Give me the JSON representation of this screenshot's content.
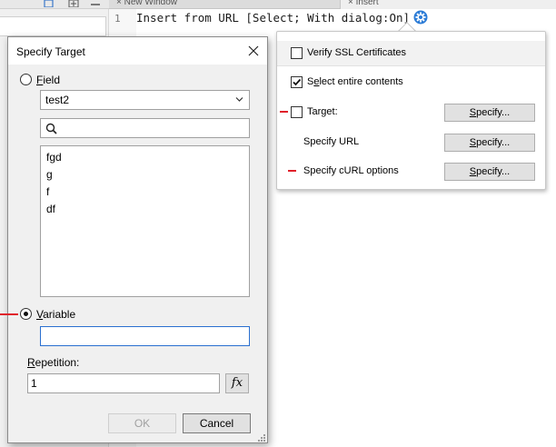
{
  "background": {
    "tabs": [
      {
        "label": "New Window"
      },
      {
        "label": "Insert"
      }
    ],
    "code": {
      "line_number": "1",
      "text": "Insert from URL [Select; With dialog:On]"
    }
  },
  "popover": {
    "rows": [
      {
        "label": "Verify SSL Certificates",
        "checked": false,
        "has_checkbox": true
      },
      {
        "label": "Select entire contents",
        "checked": true,
        "has_checkbox": true
      },
      {
        "label": "Target:",
        "checked": false,
        "has_checkbox": true,
        "button": "Specify..."
      },
      {
        "label": "Specify URL",
        "has_checkbox": false,
        "button": "Specify..."
      },
      {
        "label": "Specify cURL options",
        "has_checkbox": false,
        "button": "Specify..."
      }
    ]
  },
  "dialog": {
    "title": "Specify Target",
    "field_label": "Field",
    "field_selected": false,
    "field_value": "test2",
    "search_value": "",
    "field_list": [
      "fgd",
      "g",
      "f",
      "df"
    ],
    "variable_label": "Variable",
    "variable_selected": true,
    "variable_value": "",
    "repetition_label": "Repetition:",
    "repetition_value": "1",
    "fx_label": "fx",
    "ok_label": "OK",
    "cancel_label": "Cancel"
  },
  "colors": {
    "accent": "#2a6fd0",
    "annotation_red": "#e0202a",
    "gear_blue": "#2b7bd6"
  }
}
